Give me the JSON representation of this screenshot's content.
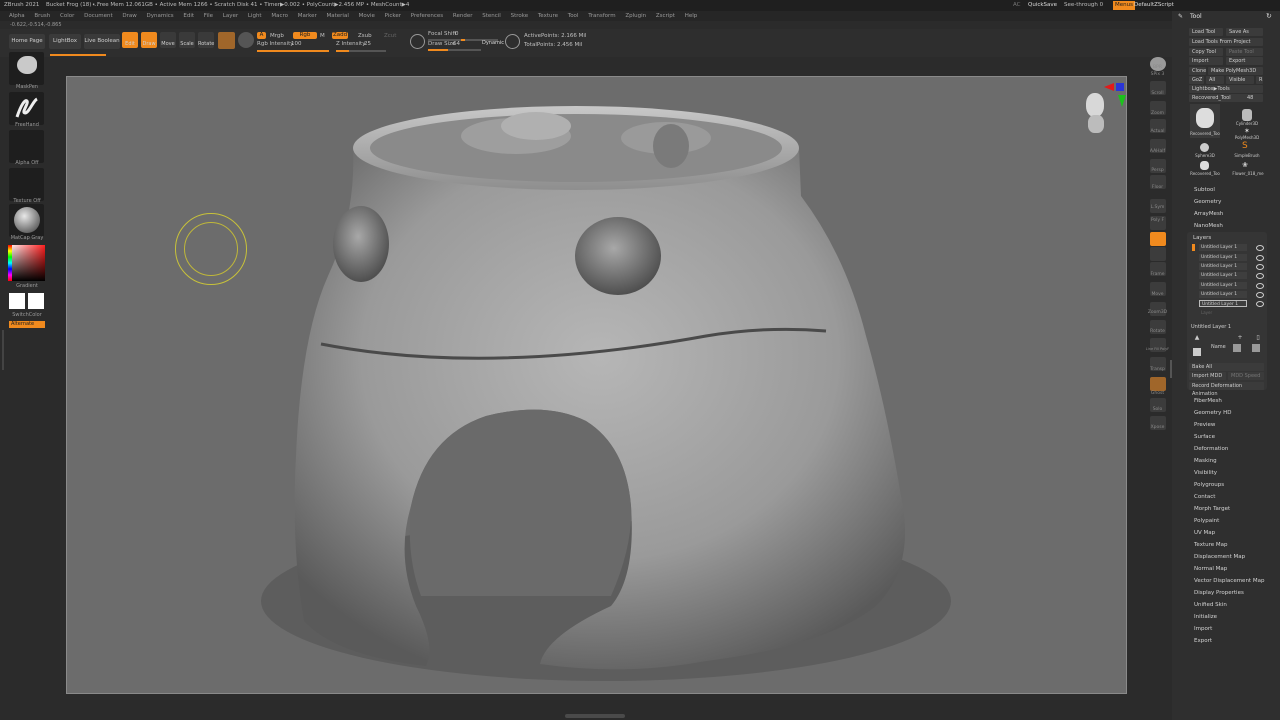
{
  "titlebar": {
    "app": "ZBrush 2021",
    "document": "Bucket Frog (18) ...",
    "stats": "• Free Mem 12.061GB • Active Mem 1266 • Scratch Disk 41 •  Timer▶0.002 • PolyCount▶2.456 MP • MeshCount▶4",
    "ac": "AC",
    "quicksave": "QuickSave",
    "seethrough": "See-through  0",
    "menus": "Menus",
    "script": "DefaultZScript"
  },
  "menubar": [
    "Alpha",
    "Brush",
    "Color",
    "Document",
    "Draw",
    "Dynamics",
    "Edit",
    "File",
    "Layer",
    "Light",
    "Macro",
    "Marker",
    "Material",
    "Movie",
    "Picker",
    "Preferences",
    "Render",
    "Stencil",
    "Stroke",
    "Texture",
    "Tool",
    "Transform",
    "Zplugin",
    "Zscript",
    "Help"
  ],
  "coords": "-0.622,-0.514,-0.865",
  "toolbar": {
    "home": "Home Page",
    "lightbox": "LightBox",
    "liveboolean": "Live Boolean",
    "edit": "Edit",
    "draw": "Draw",
    "move": "Move",
    "scale": "Scale",
    "rotate": "Rotate",
    "a": "A",
    "mrgb": "Mrgb",
    "rgb": "Rgb",
    "m": "M",
    "zadd": "Zadd",
    "zsub": "Zsub",
    "zcut": "Zcut",
    "rgb_intensity_label": "Rgb Intensity",
    "rgb_intensity": "100",
    "rgb_intensity_level": 1.0,
    "z_intensity_label": "Z Intensity",
    "z_intensity": "25",
    "z_intensity_level": 0.25,
    "focal_shift_label": "Focal Shift",
    "focal_shift": "0",
    "draw_size_label": "Draw Size",
    "draw_size": "64",
    "dynamic": "Dynamic",
    "active_points": "ActivePoints: 2.166 Mil",
    "total_points": "TotalPoints: 2.456 Mil"
  },
  "leftshelf": {
    "brush": "MaskPen",
    "stroke": "FreeHand",
    "alpha": "Alpha Off",
    "texture": "Texture Off",
    "material": "MatCap Gray",
    "gradient": "Gradient",
    "switchcolor": "SwitchColor",
    "alternate": "Alternate"
  },
  "rightshelf": [
    "BPR",
    "SPix 3",
    "Scroll",
    "Zoom",
    "Actual",
    "AAHalf",
    "Persp",
    "Floor",
    "L.Sym",
    "Poly F",
    "Frame",
    "Move",
    "Zoom3D",
    "Rotate",
    "Line Fill PolyF",
    "Transp",
    "Ghost",
    "Solo",
    "Xpose"
  ],
  "toolpanel": {
    "title": "Tool",
    "load_tool": "Load Tool",
    "save_as": "Save As",
    "load_project": "Load Tools From Project",
    "copy_tool": "Copy Tool",
    "paste_tool": "Paste Tool",
    "import": "Import",
    "export": "Export",
    "clone": "Clone",
    "make_polymesh": "Make PolyMesh3D",
    "goz": "GoZ",
    "all": "All",
    "visible": "Visible",
    "r": "R",
    "lightbox_tools": "Lightbox▶Tools",
    "recovered_tool": "Recovered_Tool",
    "recovered_count": "48",
    "tools": [
      "Recovered_Too",
      "Cylinder3D",
      "PolyMesh3D",
      "Sphere3D",
      "SimpleBrush",
      "Recovered_Too",
      "Flower_018_me"
    ],
    "sections_top": [
      "Subtool",
      "Geometry",
      "ArrayMesh",
      "NanoMesh"
    ],
    "layers_title": "Layers",
    "layers": [
      "Untitled Layer 1",
      "Untitled Layer 1",
      "Untitled Layer 1",
      "Untitled Layer 1",
      "Untitled Layer 1",
      "Untitled Layer 1",
      "Untitled Layer 1"
    ],
    "layer_ghost": "Layer",
    "current_layer": "Untitled Layer 1",
    "name": "Name",
    "bake_all": "Bake All",
    "import_mdd": "Import MDD",
    "mdd_speed": "MDD Speed",
    "record_deformation": "Record Deformation Animation",
    "sections": [
      "FiberMesh",
      "Geometry HD",
      "Preview",
      "Surface",
      "Deformation",
      "Masking",
      "Visibility",
      "Polygroups",
      "Contact",
      "Morph Target",
      "Polypaint",
      "UV Map",
      "Texture Map",
      "Displacement Map",
      "Normal Map",
      "Vector Displacement Map",
      "Display Properties",
      "Unified Skin",
      "Initialize",
      "Import",
      "Export"
    ]
  }
}
